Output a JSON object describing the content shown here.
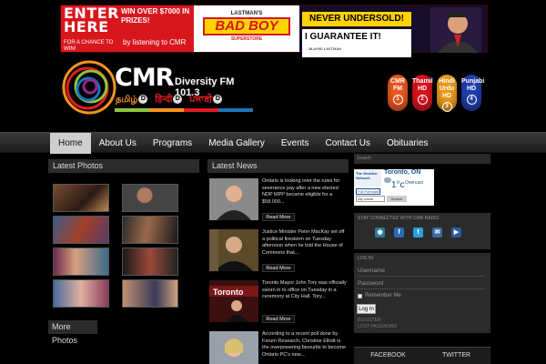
{
  "banner": {
    "enter": "ENTER HERE",
    "win_text": "WIN OVER $7000 IN PRIZES!",
    "for_chance": "FOR A CHANCE TO WIN!",
    "by_listening": "by listening to CMR",
    "lastmans": "LASTMAN'S",
    "bad_boy": "BAD BOY",
    "superstore": "SUPERSTORE",
    "never_undersold": "NEVER UNDERSOLD!",
    "guarantee": "I GUARANTEE IT!",
    "signature": "- BLAYNE LASTMAN"
  },
  "logo": {
    "cmr": "CMR",
    "diversity": "Diversity FM 101.3",
    "languages": [
      "தமிழ்",
      "हिन्दी",
      "ਪੰਜਾਬੀ"
    ],
    "lang_colors": [
      "#f7941d",
      "#e31b23",
      "#1c75bc"
    ]
  },
  "stations": [
    {
      "label": "CMR FM",
      "num": "1",
      "color": "#e8571c"
    },
    {
      "label": "Thamil HD",
      "num": "2",
      "color": "#d6141d"
    },
    {
      "label": "Hindi Urdu HD",
      "num": "3",
      "color": "#e89a19"
    },
    {
      "label": "Punjabi HD",
      "num": "4",
      "color": "#1f3fae"
    }
  ],
  "nav": [
    "Home",
    "About Us",
    "Programs",
    "Media Gallery",
    "Events",
    "Contact Us",
    "Obituaries"
  ],
  "latest_photos": {
    "title": "Latest Photos",
    "more": "More Photos"
  },
  "latest_news": {
    "title": "Latest News",
    "read_more": "Read More",
    "items": [
      {
        "text": "Ontario is looking over the rules for severance pay after a new elected NDP MPP became eligible for a $58,000..."
      },
      {
        "text": "Justice Minister Peter MacKay set off a political firestorm on Tuesday afternoon when he told the House of Commons that..."
      },
      {
        "text": "Toronto Mayor John Tory was officially sworn in to office on Tuesday in a ceremony at City Hall. Tory..."
      },
      {
        "text": "According to a recent poll done by Forum Research, Christine Elliott is the overpowering favourite to become Ontario PC's new..."
      }
    ]
  },
  "sidebar": {
    "search_placeholder": "Search",
    "weather": {
      "network": "The Weather Network",
      "city": "Toronto, ON",
      "temp": "1°c",
      "condition": "Overcast",
      "forecast": "Full Forecast",
      "city_input": "city name",
      "search_btn": "Search"
    },
    "stay_connected": "STAY CONNECTED WITH CMR RADIO",
    "social": [
      "rss",
      "f",
      "t",
      "mail",
      "yt"
    ],
    "login": {
      "title": "LOG IN",
      "username": "Username",
      "password": "Password",
      "remember": "Remember Me",
      "button": "Log In",
      "register": "REGISTER",
      "lost": "LOST PASSWORD"
    },
    "tabs": [
      "FACEBOOK",
      "TWITTER"
    ]
  }
}
